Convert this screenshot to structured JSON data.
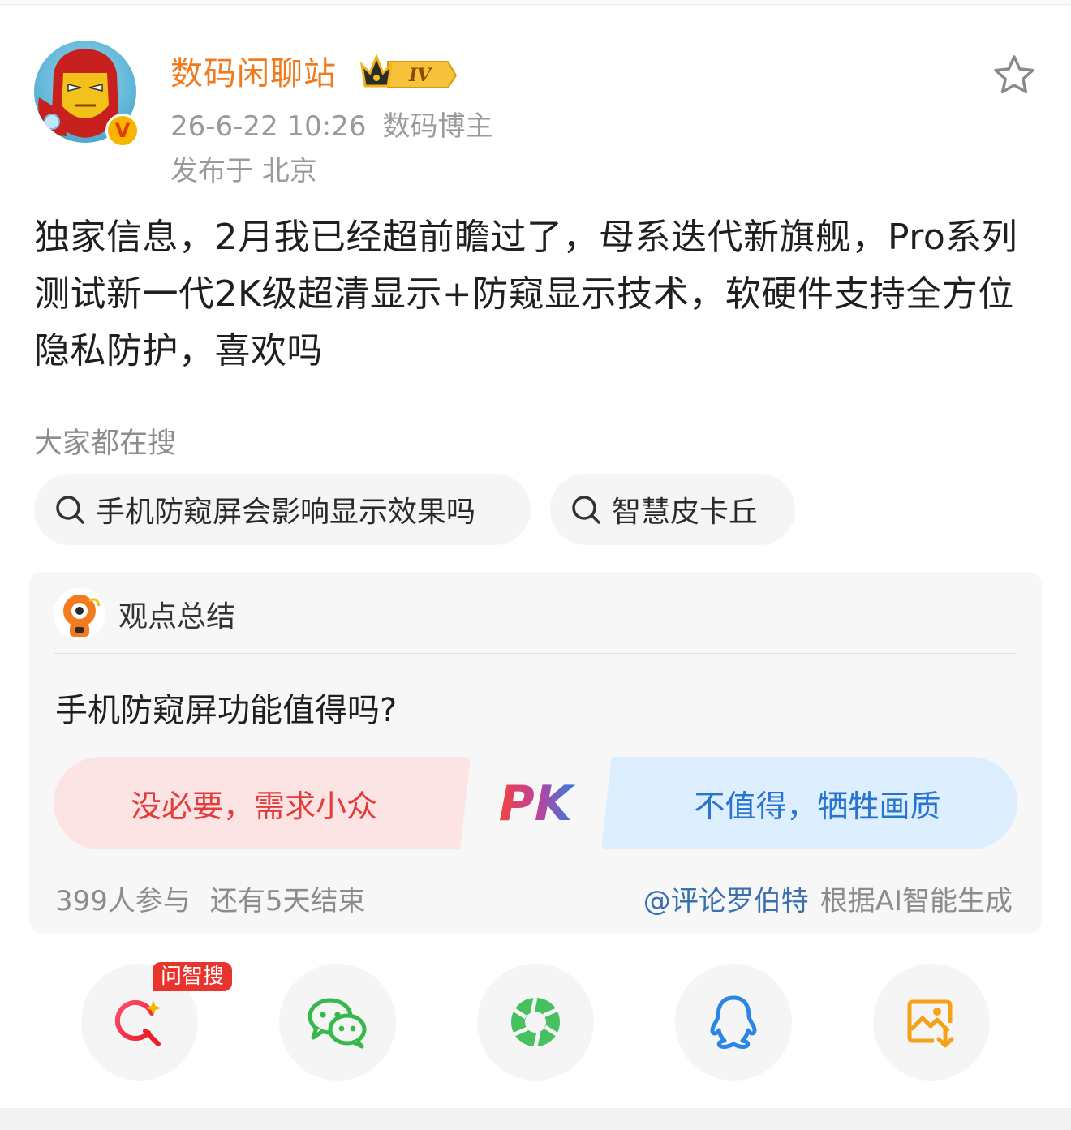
{
  "post": {
    "username": "数码闲聊站",
    "level": "IV",
    "timestamp": "26-6-22 10:26",
    "role": "数码博主",
    "location": "发布于 北京",
    "text": "独家信息，2月我已经超前瞻过了，母系迭代新旗舰，Pro系列测试新一代2K级超清显示+防窥显示技术，软硬件支持全方位隐私防护，喜欢吗"
  },
  "search": {
    "label": "大家都在搜",
    "chips": [
      "手机防窥屏会影响显示效果吗",
      "智慧皮卡丘"
    ]
  },
  "summary": {
    "title": "观点总结",
    "question": "手机防窥屏功能值得吗?",
    "option_left": "没必要，需求小众",
    "pk": "PK",
    "option_right": "不值得，牺牲画质",
    "participants": "399人参与",
    "remaining": "还有5天结束",
    "mention": "@评论罗伯特",
    "generated": "根据AI智能生成"
  },
  "share": {
    "ask_tag": "问智搜",
    "buttons": [
      "ai-search-icon",
      "wechat-icon",
      "moments-icon",
      "qq-icon",
      "save-image-icon"
    ]
  },
  "colors": {
    "username": "#f07a1e",
    "pk_left_bg": "#fde4e4",
    "pk_left_text": "#e43b3b",
    "pk_right_bg": "#ddeeff",
    "pk_right_text": "#2874cf"
  }
}
